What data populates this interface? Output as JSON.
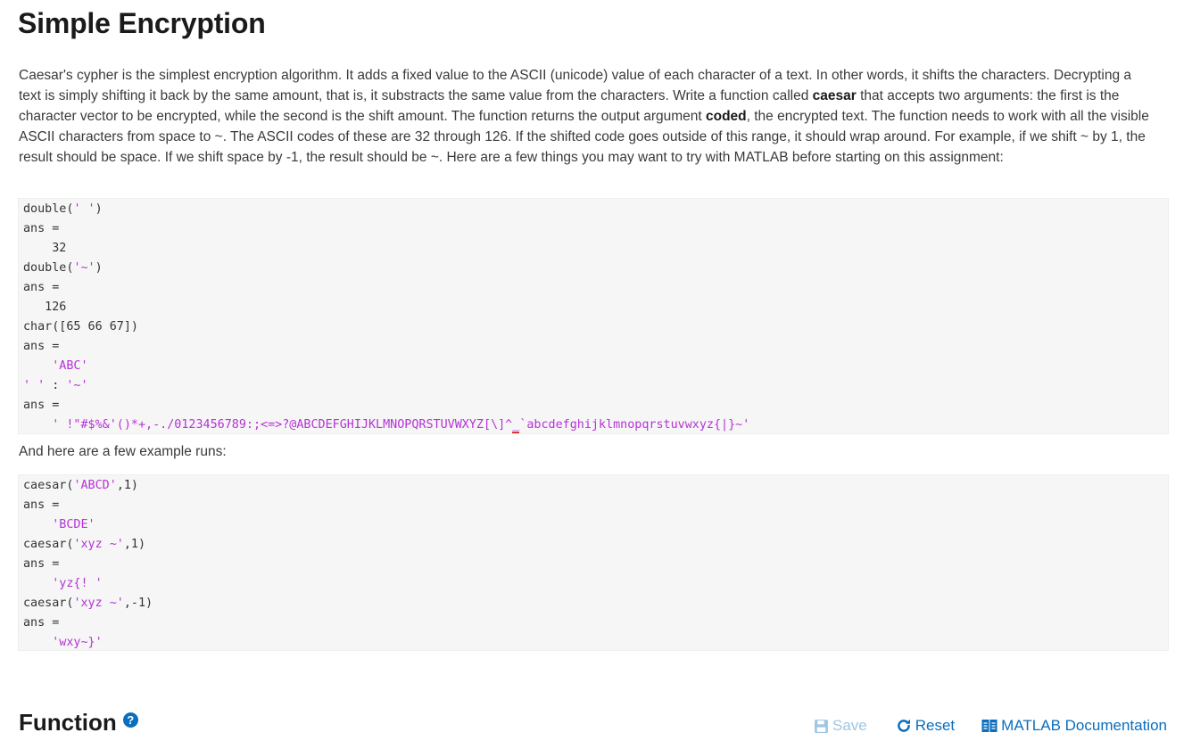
{
  "page": {
    "title": "Simple Encryption"
  },
  "description": {
    "p1": "Caesar's cypher is the simplest encryption algorithm. It adds a fixed value to the ASCII (unicode) value of each character of a text. In other words, it shifts the characters. Decrypting a text is simply shifting it back by the same amount, that is, it substracts the same value from the characters. Write a function called ",
    "b1": "caesar",
    "p2": " that accepts two arguments: the first is the character vector to be encrypted, while  the second is the shift amount. The function returns the output argument ",
    "b2": "coded",
    "p3": ", the encrypted text. The function needs to work with all the visible ASCII characters from space to ~. The ASCII codes of these are 32 through 126. If the shifted code goes outside of this range, it should wrap around. For example, if we shift ~ by 1, the result should be space. If we shift space by -1, the result should be ~. Here are a few things you may want to try with MATLAB before starting on this assignment:"
  },
  "code1": {
    "l1a": "double(",
    "l1s": "' '",
    "l1b": ")",
    "l2": "ans =",
    "l3": "    32",
    "l4a": "double(",
    "l4s": "'~'",
    "l4b": ")",
    "l5": "ans =",
    "l6": "   126",
    "l7": "char([65 66 67])",
    "l8": "ans =",
    "l9s": "    'ABC'",
    "l10s1": "' '",
    "l10m": " : ",
    "l10s2": "'~'",
    "l11": "ans =",
    "l12a": "    ' !\"#$%&'()*+,-./0123456789:;<=>?@ABCDEFGHIJKLMNOPQRSTUVWXYZ[\\]^",
    "l12u": "_",
    "l12b": "`abcdefghijklmnopqrstuvwxyz{|}~'"
  },
  "runs_text": "And here are a few example runs:",
  "code2": {
    "l1a": "caesar(",
    "l1s": "'ABCD'",
    "l1b": ",1)",
    "l2": "ans =",
    "l3s": "    'BCDE'",
    "l4a": "caesar(",
    "l4s": "'xyz ~'",
    "l4b": ",1)",
    "l5": "ans =",
    "l6s": "    'yz{! '",
    "l7a": "caesar(",
    "l7s": "'xyz ~'",
    "l7b": ",-1)",
    "l8": "ans =",
    "l9s": "    'wxy~}'"
  },
  "function_section": {
    "title": "Function",
    "help_icon_glyph": "?",
    "save_label": "Save",
    "reset_label": "Reset",
    "doc_label": "MATLAB Documentation"
  },
  "colors": {
    "accent": "#0a6ebd",
    "disabled": "#9ec6e3",
    "string": "#b533d6",
    "code_bg": "#f6f6f6"
  }
}
